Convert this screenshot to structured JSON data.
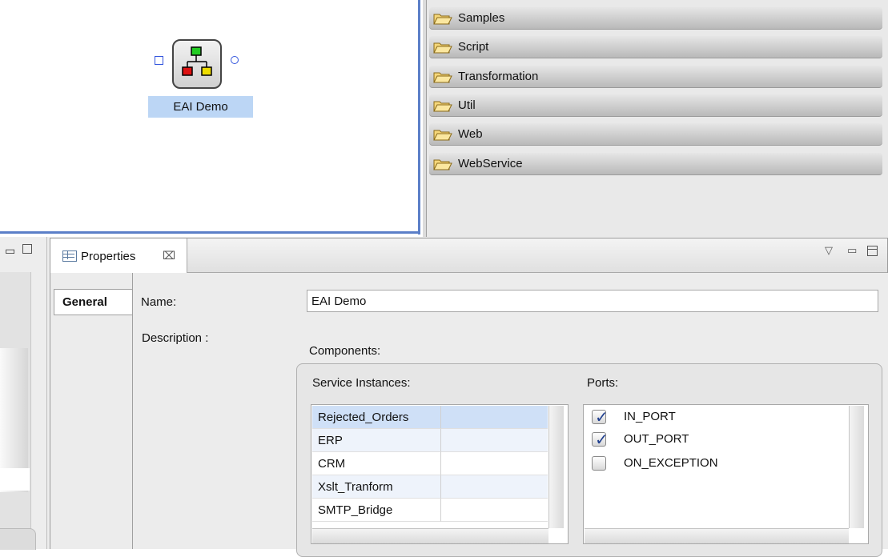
{
  "canvas": {
    "node_label": "EAI Demo"
  },
  "palette": {
    "drawers": [
      {
        "label": "Samples"
      },
      {
        "label": "Script"
      },
      {
        "label": "Transformation"
      },
      {
        "label": "Util"
      },
      {
        "label": "Web"
      },
      {
        "label": "WebService"
      }
    ]
  },
  "properties": {
    "tab_label": "Properties",
    "section_tab": "General",
    "name_label": "Name:",
    "name_value": "EAI Demo",
    "description_label": "Description :",
    "components_label": "Components:",
    "service_instances_label": "Service Instances:",
    "ports_label": "Ports:",
    "service_instances": [
      {
        "name": "Rejected_Orders"
      },
      {
        "name": "ERP"
      },
      {
        "name": "CRM"
      },
      {
        "name": "Xslt_Tranform"
      },
      {
        "name": "SMTP_Bridge"
      }
    ],
    "ports": [
      {
        "name": "IN_PORT",
        "checked": true
      },
      {
        "name": "OUT_PORT",
        "checked": true
      },
      {
        "name": "ON_EXCEPTION",
        "checked": false
      }
    ]
  },
  "colors": {
    "accent_border": "#5b7fc8",
    "selection": "#bcd6f5"
  }
}
